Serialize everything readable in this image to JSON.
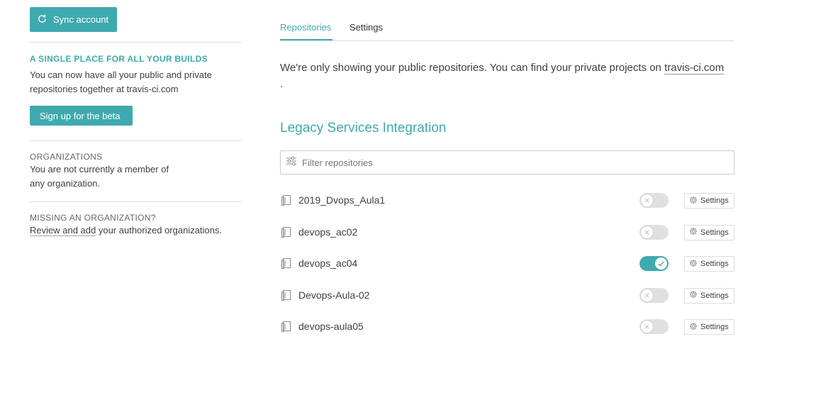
{
  "sidebar": {
    "sync_label": "Sync account",
    "beta_title": "A SINGLE PLACE FOR ALL YOUR BUILDS",
    "beta_text": "You can now have all your public and private repositories together at travis-ci.com",
    "beta_button": "Sign up for the beta",
    "orgs_title": "ORGANIZATIONS",
    "orgs_text": "You are not currently a member of any organization.",
    "missing_title": "MISSING AN ORGANIZATION?",
    "missing_link": "Review and add",
    "missing_text": " your authorized organizations."
  },
  "tabs": [
    {
      "label": "Repositories",
      "active": true
    },
    {
      "label": "Settings",
      "active": false
    }
  ],
  "notice": {
    "text": "We're only showing your public repositories. You can find your private projects on ",
    "link": "travis-ci.com",
    "tail": "."
  },
  "section_title": "Legacy Services Integration",
  "filter": {
    "placeholder": "Filter repositories",
    "value": ""
  },
  "repos": [
    {
      "name": "2019_Dvops_Aula1",
      "enabled": false,
      "settings_label": "Settings"
    },
    {
      "name": "devops_ac02",
      "enabled": false,
      "settings_label": "Settings"
    },
    {
      "name": "devops_ac04",
      "enabled": true,
      "settings_label": "Settings"
    },
    {
      "name": "Devops-Aula-02",
      "enabled": false,
      "settings_label": "Settings"
    },
    {
      "name": "devops-aula05",
      "enabled": false,
      "settings_label": "Settings"
    }
  ],
  "colors": {
    "accent": "#3eaaaf",
    "toggle_off": "#e0e0e0"
  },
  "icons": {
    "sync": "sync-icon",
    "filter": "filter-sliders-icon",
    "repo": "repo-book-icon",
    "gear": "gear-icon",
    "check": "check-icon",
    "cross": "x-icon"
  }
}
